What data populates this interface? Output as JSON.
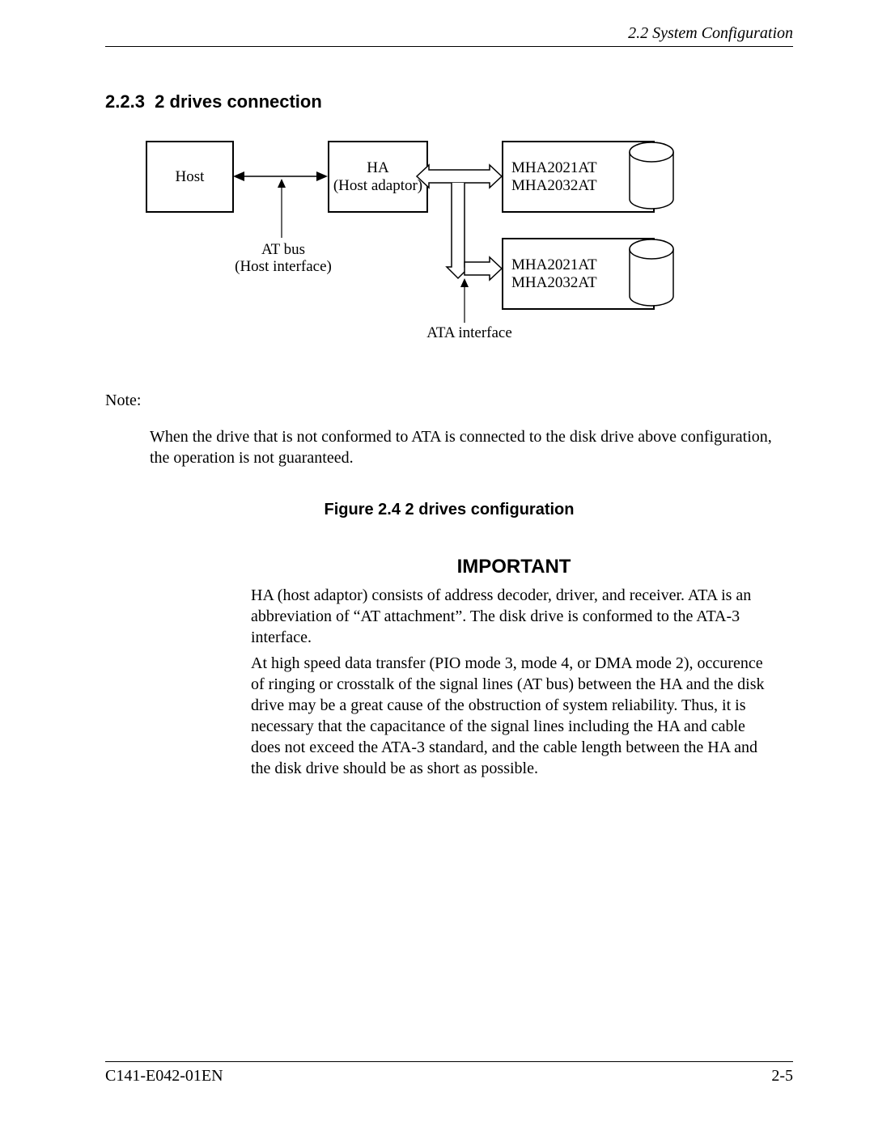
{
  "header": {
    "right": "2.2  System Configuration"
  },
  "section": {
    "number": "2.2.3",
    "title": "2 drives connection"
  },
  "diagram": {
    "host": "Host",
    "ha_line1": "HA",
    "ha_line2": "(Host adaptor)",
    "drive1_line1": "MHA2021AT",
    "drive1_line2": "MHA2032AT",
    "drive2_line1": "MHA2021AT",
    "drive2_line2": "MHA2032AT",
    "atbus_line1": "AT bus",
    "atbus_line2": "(Host interface)",
    "ata_label": "ATA interface"
  },
  "note": {
    "label": "Note:",
    "body": "When the drive that is not conformed to ATA is connected to the disk drive above configuration, the operation is not guaranteed."
  },
  "figure_caption": "Figure 2.4  2 drives configuration",
  "important": {
    "title": "IMPORTANT",
    "p1": "HA (host adaptor) consists of address decoder, driver, and receiver. ATA is an abbreviation of “AT attachment”.  The disk drive is conformed to the ATA-3 interface.",
    "p2": "At high speed data transfer (PIO mode 3, mode 4, or DMA mode 2), occurence of ringing or crosstalk of the signal lines (AT bus) between the HA and the disk drive may be a great cause of the obstruction of system reliability.  Thus, it is necessary that the capacitance of the signal lines including the HA and cable does not exceed the ATA-3 standard, and the cable length between the HA and the disk drive should be as short as possible."
  },
  "footer": {
    "left": "C141-E042-01EN",
    "right": "2-5"
  }
}
